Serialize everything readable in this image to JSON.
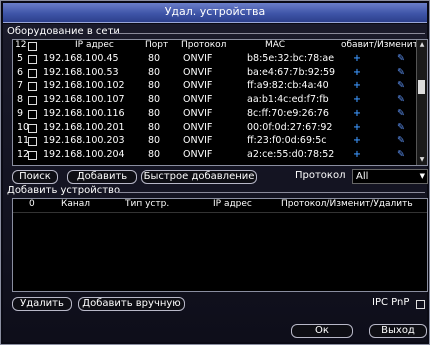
{
  "window": {
    "title": "Удал. устройства"
  },
  "network": {
    "section_label": "Оборудование в сети",
    "count": "12",
    "headers": {
      "ip": "IP адрес",
      "port": "Порт",
      "protocol": "Протокол",
      "mac": "MAC",
      "actions": "обавит/Изменит"
    },
    "rows": [
      {
        "n": "5",
        "ip": "192.168.100.45",
        "port": "80",
        "protocol": "ONVIF",
        "mac": "b8:5e:32:bc:78:ae"
      },
      {
        "n": "6",
        "ip": "192.168.100.53",
        "port": "80",
        "protocol": "ONVIF",
        "mac": "ba:e4:67:7b:92:59"
      },
      {
        "n": "7",
        "ip": "192.168.100.102",
        "port": "80",
        "protocol": "ONVIF",
        "mac": "ff:a9:82:cb:4a:40"
      },
      {
        "n": "8",
        "ip": "192.168.100.107",
        "port": "80",
        "protocol": "ONVIF",
        "mac": "aa:b1:4c:ed:f7:fb"
      },
      {
        "n": "9",
        "ip": "192.168.100.116",
        "port": "80",
        "protocol": "ONVIF",
        "mac": "8c:ff:70:e9:26:76"
      },
      {
        "n": "10",
        "ip": "192.168.100.201",
        "port": "80",
        "protocol": "ONVIF",
        "mac": "00:0f:0d:27:67:92"
      },
      {
        "n": "11",
        "ip": "192.168.100.203",
        "port": "80",
        "protocol": "ONVIF",
        "mac": "ff:23:f0:0d:69:5c"
      },
      {
        "n": "12",
        "ip": "192.168.100.204",
        "port": "80",
        "protocol": "ONVIF",
        "mac": "a2:ce:55:d0:78:52"
      }
    ],
    "plus_glyph": "+",
    "edit_glyph": "✎"
  },
  "toolbar1": {
    "search": "Поиск",
    "add": "Добавить",
    "quick_add": "Быстрое добавление",
    "protocol_label": "Протокол",
    "protocol_value": "All"
  },
  "added": {
    "section_label": "Добавить устройство",
    "headers": {
      "num": "0",
      "channel": "Канал",
      "type": "Тип устр.",
      "ip": "IP адрес",
      "proto": "Протокол/Изменит/Удалить"
    }
  },
  "toolbar2": {
    "delete": "Удалить",
    "manual_add": "Добавить вручную",
    "ipc_pnp": "IPC PnP"
  },
  "footer": {
    "ok": "Ок",
    "exit": "Выход"
  },
  "icons": {
    "scroll_up": "▲",
    "scroll_down": "▼",
    "dropdown": "▼"
  },
  "colors": {
    "title_bar": "#3f55a8",
    "add_icon": "#3a8ff0",
    "edit_icon": "#5b8ff0"
  }
}
